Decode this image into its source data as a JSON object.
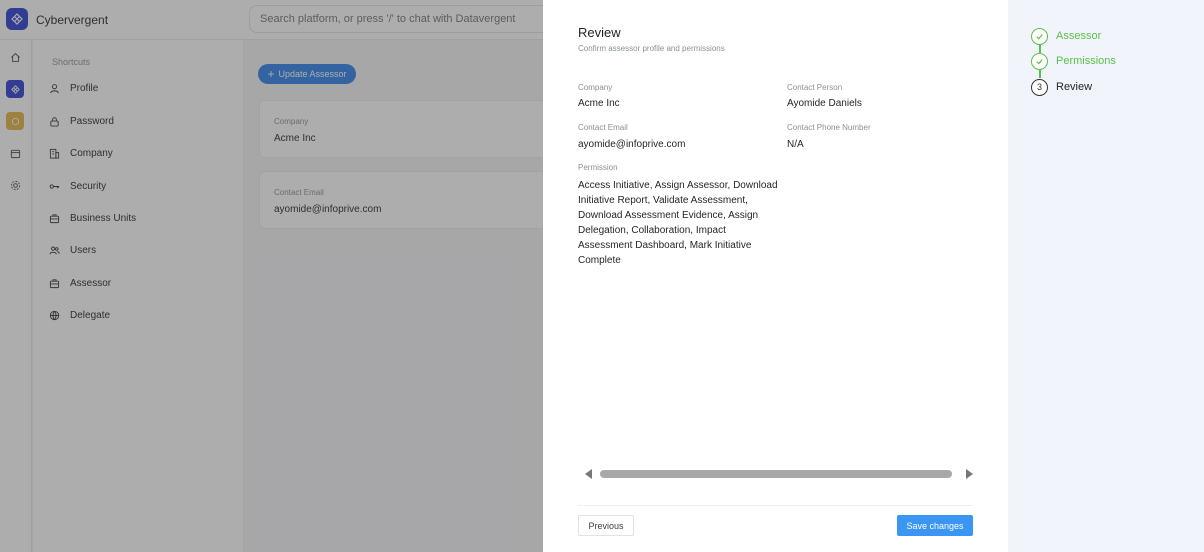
{
  "app": {
    "name": "Cybervergent",
    "search_placeholder": "Search platform, or press '/' to chat with Datavergent"
  },
  "sidebar": {
    "heading": "Shortcuts",
    "items": [
      {
        "label": "Profile",
        "icon": "user-icon"
      },
      {
        "label": "Password",
        "icon": "lock-icon"
      },
      {
        "label": "Company",
        "icon": "building-icon"
      },
      {
        "label": "Security",
        "icon": "key-icon"
      },
      {
        "label": "Business Units",
        "icon": "briefcase-icon"
      },
      {
        "label": "Users",
        "icon": "users-icon"
      },
      {
        "label": "Assessor",
        "icon": "briefcase-icon"
      },
      {
        "label": "Delegate",
        "icon": "globe-icon"
      }
    ]
  },
  "background": {
    "update_button": "Update Assessor",
    "company_label": "Company",
    "company_value": "Acme Inc",
    "email_label": "Contact Email",
    "email_value": "ayomide@infoprive.com"
  },
  "review": {
    "title": "Review",
    "subtitle": "Confirm assessor profile and permissions",
    "company_label": "Company",
    "company_value": "Acme Inc",
    "contact_person_label": "Contact Person",
    "contact_person_value": "Ayomide Daniels",
    "contact_email_label": "Contact Email",
    "contact_email_value": "ayomide@infoprive.com",
    "contact_phone_label": "Contact Phone Number",
    "contact_phone_value": "N/A",
    "permission_label": "Permission",
    "permission_value": "Access Initiative, Assign Assessor, Download Initiative Report, Validate Assessment, Download Assessment Evidence, Assign Delegation, Collaboration, Impact Assessment Dashboard, Mark Initiative Complete",
    "previous_button": "Previous",
    "save_button": "Save changes"
  },
  "stepper": {
    "steps": [
      {
        "label": "Assessor",
        "status": "done"
      },
      {
        "label": "Permissions",
        "status": "done"
      },
      {
        "label": "Review",
        "status": "current",
        "number": "3"
      }
    ],
    "done_color": "#5cc04a"
  },
  "colors": {
    "primary": "#2f80ed",
    "save": "#3b95f2",
    "logo": "#2a3fd1",
    "stepper_bg": "#f1f4fb"
  }
}
